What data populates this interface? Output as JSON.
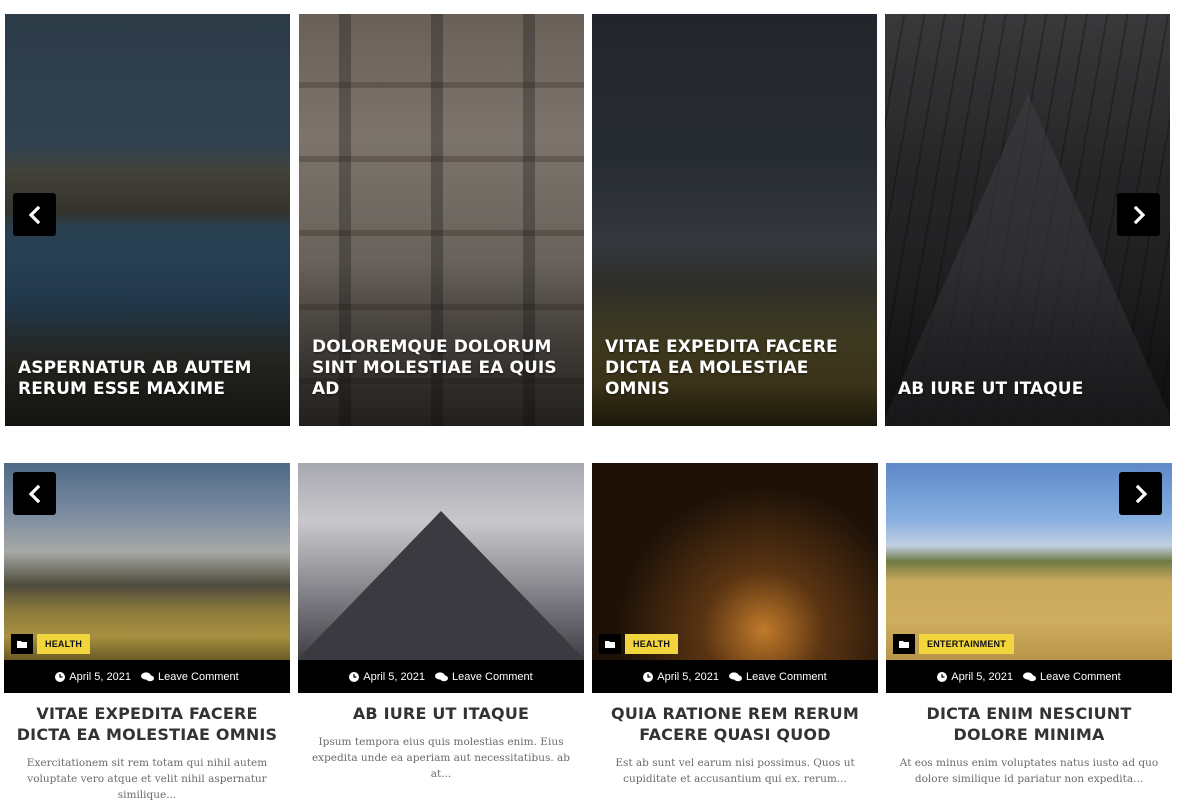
{
  "top_slider": {
    "slides": [
      {
        "title": "ASPERNATUR AB AUTEM RERUM ESSE MAXIME"
      },
      {
        "title": "DOLOREMQUE DOLORUM SINT MOLESTIAE EA QUIS AD"
      },
      {
        "title": "VITAE EXPEDITA FACERE DICTA EA MOLESTIAE OMNIS"
      },
      {
        "title": "AB IURE UT ITAQUE"
      }
    ]
  },
  "bottom_slider": {
    "cards": [
      {
        "category": "HEALTH",
        "date": "April 5, 2021",
        "comment": "Leave Comment",
        "title": "VITAE EXPEDITA FACERE DICTA EA MOLESTIAE OMNIS",
        "excerpt": "Exercitationem sit rem totam qui nihil autem voluptate vero atque et velit nihil aspernatur similique..."
      },
      {
        "category": "",
        "date": "April 5, 2021",
        "comment": "Leave Comment",
        "title": "AB IURE UT ITAQUE",
        "excerpt": "Ipsum tempora eius quis molestias enim. Eius expedita unde ea aperiam aut necessitatibus. ab at..."
      },
      {
        "category": "HEALTH",
        "date": "April 5, 2021",
        "comment": "Leave Comment",
        "title": "QUIA RATIONE REM RERUM FACERE QUASI QUOD",
        "excerpt": "Est ab sunt vel earum nisi possimus. Quos ut cupiditate et accusantium qui ex. rerum..."
      },
      {
        "category": "ENTERTAINMENT",
        "date": "April 5, 2021",
        "comment": "Leave Comment",
        "title": "DICTA ENIM NESCIUNT DOLORE MINIMA",
        "excerpt": "At eos minus enim voluptates natus iusto ad quo dolore similique id pariatur non expedita..."
      }
    ]
  },
  "icons": {
    "prev": "chevron-left-icon",
    "next": "chevron-right-icon",
    "folder": "folder-icon",
    "clock": "clock-icon",
    "comments": "comments-icon"
  },
  "colors": {
    "category_badge": "#f2d43d",
    "meta_bar": "#000000",
    "arrow_bg": "#000000"
  }
}
